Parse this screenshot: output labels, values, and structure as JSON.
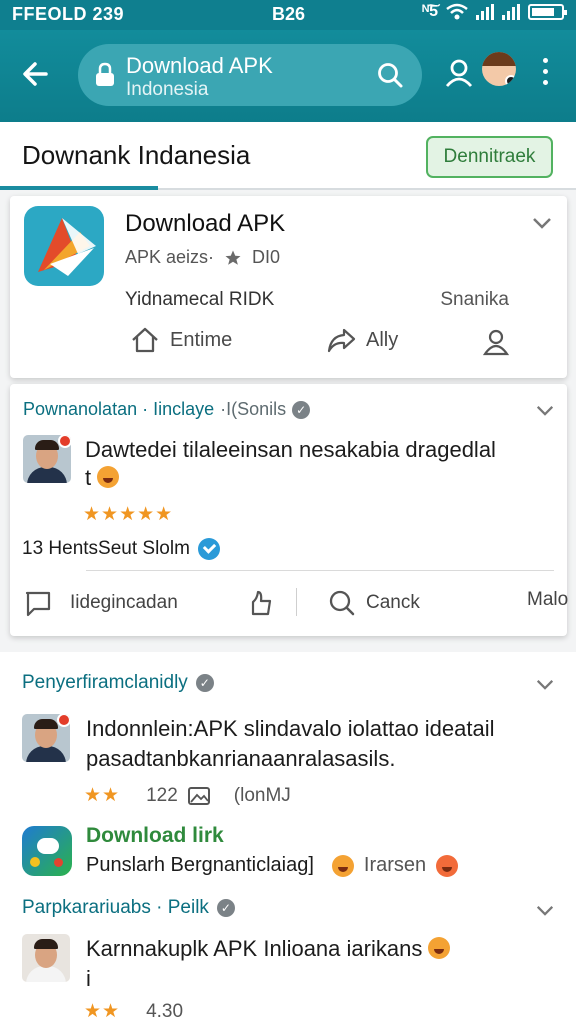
{
  "status_bar": {
    "left": "FFEOLD 239",
    "time": "B26",
    "network": "ᴺ͠5"
  },
  "url_bar": {
    "title": "Download APK",
    "subtitle": "Indonesia"
  },
  "section": {
    "title": "Downank Indanesia",
    "button_label": "Dennitraek"
  },
  "app_card": {
    "name": "Download APK",
    "meta": "APK aeizs·",
    "rating_label": "DI0",
    "row2_left": "Yidnamecal RIDK",
    "row2_right": "Snanika",
    "actions": [
      "Entime",
      "Ally"
    ]
  },
  "post_card": {
    "header": "Pownanolatan · Iinclaye",
    "header_sub": "·I(Sonils",
    "text": "Dawtedei tilaleeinsan nesakabia dragedlal",
    "text_line2": "t",
    "stars": "★★★★★",
    "source": "13 HentsSeut Slolm",
    "actions": [
      "Iidegincadan",
      "Canck",
      "Malo"
    ]
  },
  "feed": {
    "section1_title": "Penyerfiramclanidly",
    "item1_text": "Indonnlein:APK slindavalo iolattao ideatail pasadtanbkanrianaanralasasils.",
    "item1_stars": "★★",
    "item1_count": "122",
    "item1_tag": "(lonMJ",
    "item2_title": "Download lirk",
    "item2_text": "Punslarh Bergnanticlaiag]",
    "item2_tag": "Irarsen",
    "section2_title": "Parpkarariuabs · Peilk",
    "item3_text": "Karnnakuplk APK Inlioana iarikans",
    "item3_line2": "i",
    "item3_stars": "★★",
    "item3_count": "4.30"
  },
  "colors": {
    "header_bg": "#0f7f8f",
    "accent": "#1a8ca0",
    "button_green": "#52b260",
    "star": "#f09622"
  }
}
